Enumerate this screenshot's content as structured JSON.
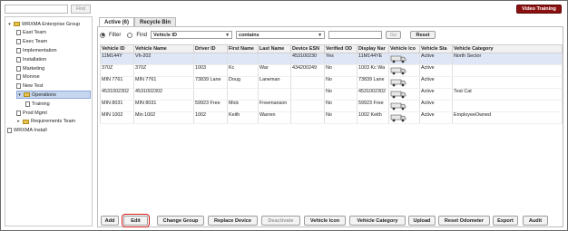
{
  "left": {
    "search": {
      "placeholder": "",
      "button_label": "Find"
    },
    "tree": [
      {
        "label": "WRXMA Enterprise Group",
        "type": "folder",
        "toggle": "▾",
        "level": 0
      },
      {
        "label": "East Team",
        "type": "page",
        "level": 1
      },
      {
        "label": "Exec Team",
        "type": "page",
        "level": 1
      },
      {
        "label": "Implementation",
        "type": "page",
        "level": 1
      },
      {
        "label": "Installation",
        "type": "page",
        "level": 1
      },
      {
        "label": "Marketing",
        "type": "page",
        "level": 1
      },
      {
        "label": "Monroe",
        "type": "page",
        "level": 1
      },
      {
        "label": "New Test",
        "type": "page",
        "level": 1
      },
      {
        "label": "Operations",
        "type": "folder",
        "toggle": "▾",
        "level": 1,
        "selected": true
      },
      {
        "label": "Training",
        "type": "page",
        "level": 2
      },
      {
        "label": "Prod Mgmt",
        "type": "page",
        "level": 1
      },
      {
        "label": "Requirements Team",
        "type": "folder",
        "toggle": "▸",
        "level": 1
      },
      {
        "label": "WRXMA Install",
        "type": "page",
        "level": 0
      }
    ]
  },
  "header": {
    "video_training_label": "Video Training"
  },
  "tabs": [
    {
      "label": "Active (6)",
      "active": true
    },
    {
      "label": "Recycle Bin",
      "active": false
    }
  ],
  "filter": {
    "filter_label": "Filter",
    "find_label": "Find",
    "field_value": "Vehicle ID",
    "operator_value": "contains",
    "search_value": "",
    "go_label": "Go",
    "reset_label": "Reset"
  },
  "table": {
    "columns": [
      "Vehicle ID",
      "Vehicle Name",
      "Driver ID",
      "First Name",
      "Last Name",
      "Device ESN",
      "Verified OD",
      "Display Nar",
      "Vehicle Ico",
      "Vehicle Sta",
      "Vehicle Category"
    ],
    "rows": [
      {
        "cells": [
          "11M144Y",
          "Vh-202",
          "",
          "",
          "",
          "453100230",
          "Yes",
          "11M144YE",
          "",
          "Active",
          "North Sector"
        ],
        "selected": true,
        "icon": "truck-icon"
      },
      {
        "cells": [
          "370Z",
          "370Z",
          "1003",
          "Kc",
          "War",
          "434200249",
          "No",
          "1003 Kc Wa",
          "",
          "Active",
          ""
        ],
        "selected": false,
        "icon": "truck-icon"
      },
      {
        "cells": [
          "MIN 7761",
          "MIN 7761",
          "73839 Lane",
          "Doug",
          "Laneman",
          "",
          "No",
          "73839 Lane",
          "",
          "Active",
          ""
        ],
        "selected": false,
        "icon": "truck-icon"
      },
      {
        "cells": [
          "4531002302",
          "4531002302",
          "",
          "",
          "",
          "",
          "No",
          "4531002302",
          "",
          "Active",
          "Test Cat"
        ],
        "selected": false,
        "icon": "truck-icon"
      },
      {
        "cells": [
          "MIN 8031",
          "MIN 8031",
          "59923 Free",
          "Mick",
          "Freemanson",
          "",
          "No",
          "59923 Free",
          "",
          "Active",
          ""
        ],
        "selected": false,
        "icon": "truck-icon"
      },
      {
        "cells": [
          "MIN 1002",
          "Min 1002",
          "1002",
          "Keith",
          "Warren",
          "",
          "No",
          "1002 Keith",
          "",
          "Active",
          "EmployeeOwned"
        ],
        "selected": false,
        "icon": "truck-icon"
      }
    ]
  },
  "buttons": [
    {
      "label": "Add",
      "disabled": false
    },
    {
      "label": "Edit",
      "disabled": false,
      "highlight": true
    },
    {
      "label": "Change Group",
      "disabled": false
    },
    {
      "label": "Replace Device",
      "disabled": false
    },
    {
      "label": "Deactivate",
      "disabled": true
    },
    {
      "label": "Vehicle Icon",
      "disabled": false
    },
    {
      "label": "Vehicle Category",
      "disabled": false
    },
    {
      "label": "Upload",
      "disabled": false
    },
    {
      "label": "Reset Odometer",
      "disabled": false
    },
    {
      "label": "Export",
      "disabled": false
    },
    {
      "label": "Audit",
      "disabled": false
    }
  ],
  "colors": {
    "video_button": "#8b1010",
    "highlight": "#d11a1a",
    "selection": "#c7d7ef"
  }
}
